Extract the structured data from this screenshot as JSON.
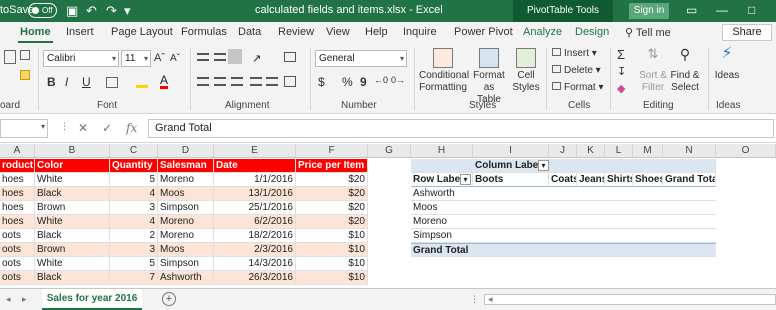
{
  "titlebar": {
    "autosave_label": "toSave",
    "autosave_state": "Off",
    "doc_title": "calculated fields and items.xlsx - Excel",
    "context_tools": "PivotTable Tools",
    "signin": "Sign in",
    "save_icon": "▣",
    "undo_icon": "↶",
    "redo_icon": "↷",
    "qat_more_icon": "▾",
    "display_icon": "▭",
    "minimize_icon": "—",
    "restore_icon": "□"
  },
  "tabs": [
    "Home",
    "Insert",
    "Page Layout",
    "Formulas",
    "Data",
    "Review",
    "View",
    "Help",
    "Inquire",
    "Power Pivot"
  ],
  "context_tabs": [
    "Analyze",
    "Design"
  ],
  "tellme": "Tell me",
  "share": "Share",
  "ribbon": {
    "font_name": "Calibri",
    "font_size": "11",
    "number_format": "General",
    "group_clipboard": "oard",
    "group_font": "Font",
    "group_alignment": "Alignment",
    "group_number": "Number",
    "group_styles": "Styles",
    "group_cells": "Cells",
    "group_editing": "Editing",
    "group_ideas": "Ideas",
    "bold": "B",
    "italic": "I",
    "underline": "U",
    "currency": "$",
    "percent": "%",
    "comma": "9",
    "cond_formatting_1": "Conditional",
    "cond_formatting_2": "Formatting",
    "format_table_1": "Format as",
    "format_table_2": "Table",
    "cell_styles_1": "Cell",
    "cell_styles_2": "Styles",
    "insert": "Insert",
    "delete": "Delete",
    "format": "Format",
    "sort_filter_1": "Sort &",
    "sort_filter_2": "Filter",
    "find_select_1": "Find &",
    "find_select_2": "Select",
    "ideas": "Ideas"
  },
  "formula_bar": {
    "cancel": "✕",
    "enter": "✓",
    "fx": "fx",
    "value": "Grand Total"
  },
  "columns": [
    "A",
    "B",
    "C",
    "D",
    "E",
    "F",
    "G",
    "H",
    "I",
    "J",
    "K",
    "L",
    "M",
    "N",
    "O"
  ],
  "table": {
    "headers": [
      "roduct",
      "Color",
      "Quantity",
      "Salesman",
      "Date",
      "Price per Item"
    ],
    "rows": [
      [
        "hoes",
        "White",
        "5",
        "Moreno",
        "1/1/2016",
        "$20"
      ],
      [
        "hoes",
        "Black",
        "4",
        "Moos",
        "13/1/2016",
        "$20"
      ],
      [
        "hoes",
        "Brown",
        "3",
        "Simpson",
        "25/1/2016",
        "$20"
      ],
      [
        "hoes",
        "White",
        "4",
        "Moreno",
        "6/2/2016",
        "$20"
      ],
      [
        "oots",
        "Black",
        "2",
        "Moreno",
        "18/2/2016",
        "$10"
      ],
      [
        "oots",
        "Brown",
        "3",
        "Moos",
        "2/3/2016",
        "$10"
      ],
      [
        "oots",
        "White",
        "5",
        "Simpson",
        "14/3/2016",
        "$10"
      ],
      [
        "oots",
        "Black",
        "7",
        "Ashworth",
        "26/3/2016",
        "$10"
      ]
    ]
  },
  "pivot": {
    "column_labels": "Column Labels",
    "filter_icon": "▾",
    "row_labels": "Row Labels",
    "col_headers": [
      "Boots",
      "Coats",
      "Jeans",
      "Shirts",
      "Shoes",
      "Grand Total"
    ],
    "rows": [
      "Ashworth",
      "Moos",
      "Moreno",
      "Simpson"
    ],
    "grand_total": "Grand Total"
  },
  "sheet_tab": "Sales for year 2016",
  "add_sheet": "+",
  "nav_prev": "◂",
  "nav_next": "▸",
  "scroll_left": "◂"
}
